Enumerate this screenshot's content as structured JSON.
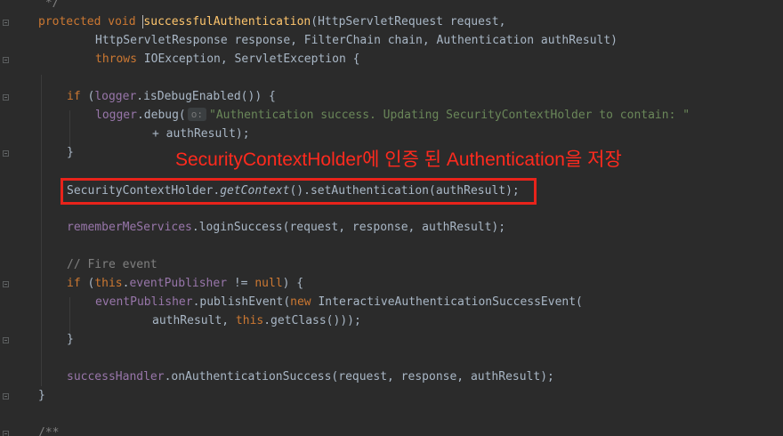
{
  "editor": {
    "line_comment_end": " */",
    "l1": {
      "protected": "protected",
      "void": "void",
      "method": "successfulAuthentication",
      "params": "(HttpServletRequest request,"
    },
    "l2": "HttpServletResponse response, FilterChain chain, Authentication authResult)",
    "l3": {
      "throws": "throws",
      "rest": " IOException, ServletException {"
    },
    "l5": {
      "if": "if",
      "open": " (",
      "logger": "logger",
      "rest": ".isDebugEnabled()) {"
    },
    "l6": {
      "logger": "logger",
      "call": ".debug(",
      "hint": "o:",
      "string": "\"Authentication success. Updating SecurityContextHolder to contain: \""
    },
    "l7": "+ authResult);",
    "l8": "}",
    "l10": {
      "cls": "SecurityContextHolder.",
      "static_method": "getContext",
      "rest": "().setAuthentication(authResult);"
    },
    "l12": {
      "field": "rememberMeServices",
      "rest": ".loginSuccess(request, response, authResult);"
    },
    "l14": "// Fire event",
    "l15": {
      "if": "if",
      "open": " (",
      "this": "this",
      "dot": ".",
      "field": "eventPublisher",
      "ne": " != ",
      "null": "null",
      "close": ") {"
    },
    "l16": {
      "field": "eventPublisher",
      "call": ".publishEvent(",
      "new": "new",
      "rest": " InteractiveAuthenticationSuccessEvent("
    },
    "l17": {
      "pre": "authResult, ",
      "this": "this",
      "rest": ".getClass()));"
    },
    "l18": "}",
    "l20": {
      "field": "successHandler",
      "rest": ".onAuthenticationSuccess(request, response, authResult);"
    },
    "l21": "}",
    "l23": "/**"
  },
  "annotation": {
    "text": "SecurityContextHolder에 인증 된 Authentication을 저장"
  },
  "colors": {
    "background": "#2b2b2b",
    "keyword": "#cc7832",
    "method_decl": "#ffc66d",
    "field": "#9876aa",
    "string": "#6a8759",
    "comment": "#808080",
    "annotation_red": "#ff2a1e"
  }
}
